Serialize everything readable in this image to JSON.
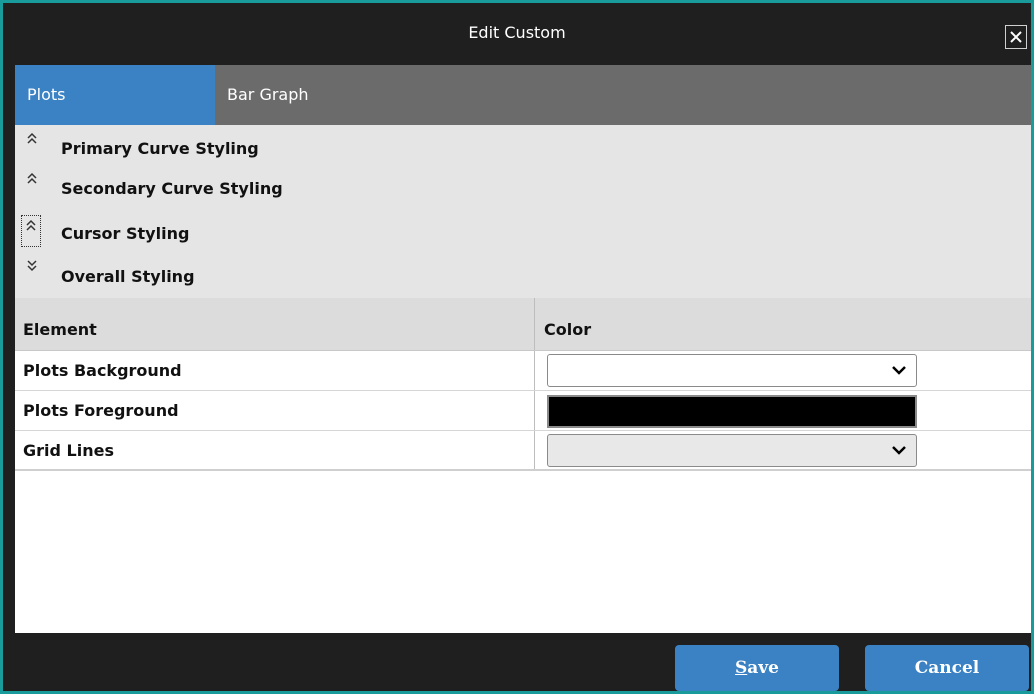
{
  "window": {
    "title": "Edit Custom",
    "close_icon": "close-icon"
  },
  "tabs": [
    {
      "label": "Plots",
      "active": true
    },
    {
      "label": "Bar Graph",
      "active": false
    }
  ],
  "sections": [
    {
      "label": "Primary Curve Styling",
      "icon": "chevron-double-up-icon",
      "expanded": false
    },
    {
      "label": "Secondary Curve Styling",
      "icon": "chevron-double-up-icon",
      "expanded": false
    },
    {
      "label": "Cursor Styling",
      "icon": "chevron-double-up-icon",
      "expanded": false,
      "focused": true
    },
    {
      "label": "Overall Styling",
      "icon": "chevron-double-down-icon",
      "expanded": true
    }
  ],
  "table": {
    "columns": [
      "Element",
      "Color"
    ],
    "rows": [
      {
        "element": "Plots Background",
        "color": "#ffffff",
        "editor": "dropdown"
      },
      {
        "element": "Plots Foreground",
        "color": "#000000",
        "editor": "swatch"
      },
      {
        "element": "Grid Lines",
        "color": "#e8e8e8",
        "editor": "dropdown"
      }
    ]
  },
  "footer": {
    "save_label": "Save",
    "cancel_label": "Cancel"
  },
  "colors": {
    "accent": "#3b82c4",
    "border": "#1a9b9b",
    "tab_bar": "#6b6b6b",
    "section_bg": "#e5e5e5"
  }
}
